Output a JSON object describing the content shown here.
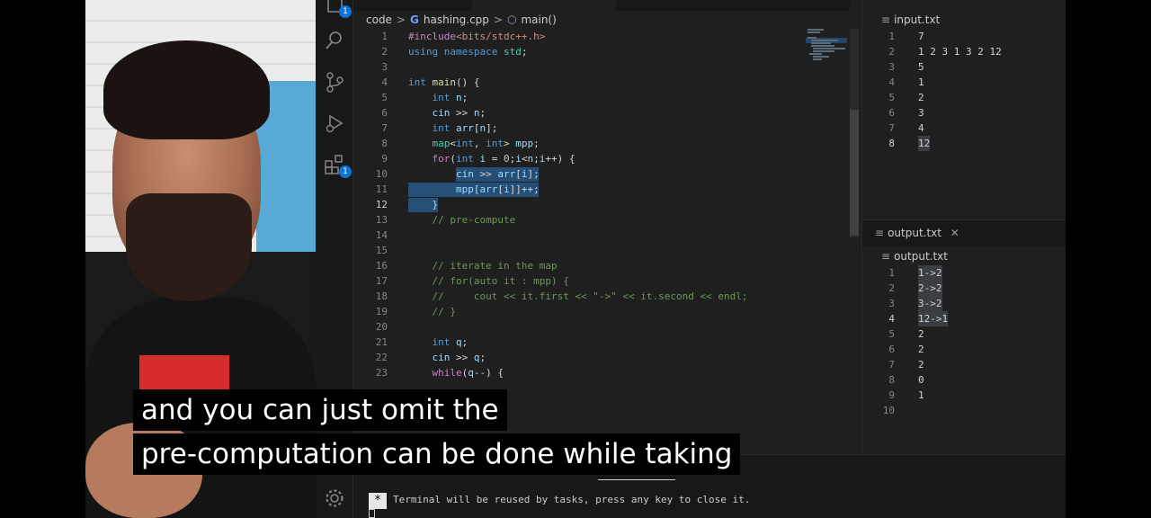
{
  "breadcrumb": {
    "folder": "code",
    "file": "hashing.cpp",
    "symbol": "main()"
  },
  "activity_bar": {
    "explorer_badge": "1",
    "extensions_badge": "1"
  },
  "code_lines": [
    {
      "n": "1",
      "text": "#include<bits/stdc++.h>"
    },
    {
      "n": "2",
      "text": "using namespace std;"
    },
    {
      "n": "3",
      "text": ""
    },
    {
      "n": "4",
      "text": "int main() {"
    },
    {
      "n": "5",
      "text": "    int n;"
    },
    {
      "n": "6",
      "text": "    cin >> n;"
    },
    {
      "n": "7",
      "text": "    int arr[n];"
    },
    {
      "n": "8",
      "text": "    map<int, int> mpp;"
    },
    {
      "n": "9",
      "text": "    for(int i = 0;i<n;i++) {"
    },
    {
      "n": "10",
      "text": "        cin >> arr[i];"
    },
    {
      "n": "11",
      "text": "        mpp[arr[i]]++;"
    },
    {
      "n": "12",
      "text": "    }"
    },
    {
      "n": "13",
      "text": "    // pre-compute"
    },
    {
      "n": "14",
      "text": ""
    },
    {
      "n": "15",
      "text": ""
    },
    {
      "n": "16",
      "text": "    // iterate in the map"
    },
    {
      "n": "17",
      "text": "    // for(auto it : mpp) {"
    },
    {
      "n": "18",
      "text": "    //     cout << it.first << \"->\" << it.second << endl;"
    },
    {
      "n": "19",
      "text": "    // }"
    },
    {
      "n": "20",
      "text": ""
    },
    {
      "n": "21",
      "text": "    int q;"
    },
    {
      "n": "22",
      "text": "    cin >> q;"
    },
    {
      "n": "23",
      "text": "    while(q--) {"
    }
  ],
  "current_line": "12",
  "input_pane": {
    "title": "input.txt",
    "lines": [
      {
        "n": "1",
        "text": "7"
      },
      {
        "n": "2",
        "text": "1 2 3 1 3 2 12"
      },
      {
        "n": "3",
        "text": "5"
      },
      {
        "n": "4",
        "text": "1"
      },
      {
        "n": "5",
        "text": "2"
      },
      {
        "n": "6",
        "text": "3"
      },
      {
        "n": "7",
        "text": "4"
      },
      {
        "n": "8",
        "text": "12"
      }
    ]
  },
  "output_pane": {
    "tab_label": "output.txt",
    "title": "output.txt",
    "lines": [
      {
        "n": "1",
        "text": "1->2"
      },
      {
        "n": "2",
        "text": "2->2"
      },
      {
        "n": "3",
        "text": "3->2"
      },
      {
        "n": "4",
        "text": "12->1"
      },
      {
        "n": "5",
        "text": "2"
      },
      {
        "n": "6",
        "text": "2"
      },
      {
        "n": "7",
        "text": "2"
      },
      {
        "n": "8",
        "text": "0"
      },
      {
        "n": "9",
        "text": "1"
      },
      {
        "n": "10",
        "text": ""
      }
    ]
  },
  "terminal": {
    "prompt_symbol": "*",
    "message": "Terminal will be reused by tasks, press any key to close it."
  },
  "subtitles": {
    "line1": "and you can just omit the",
    "line2": "pre-computation can be done while taking"
  },
  "colors": {
    "editor_bg": "#1f1f1f",
    "selection": "#264f78",
    "keyword": "#569cd6",
    "comment": "#6a9955",
    "badge": "#0b74d9"
  },
  "icons": [
    "files-icon",
    "search-icon",
    "source-control-icon",
    "run-debug-icon",
    "extensions-icon",
    "settings-gear-icon",
    "close-icon"
  ]
}
